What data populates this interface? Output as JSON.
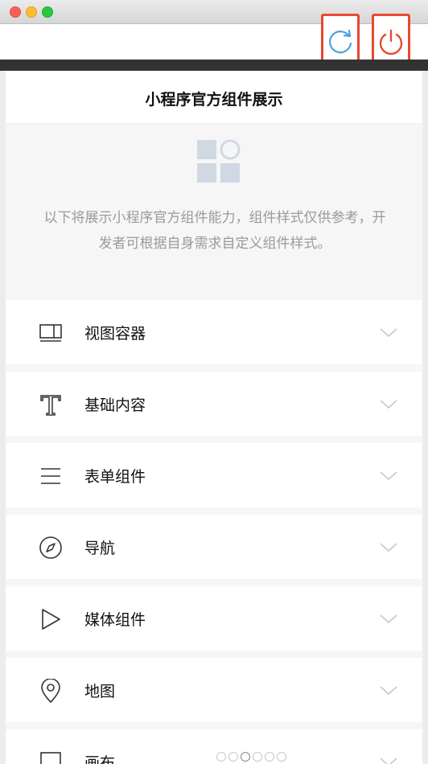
{
  "window": {
    "controls": [
      "close",
      "minimize",
      "zoom"
    ]
  },
  "toolbar": {
    "refresh_label": "刷新",
    "end_label": "结束",
    "refresh_icon": "refresh-icon",
    "power_icon": "power-icon",
    "accent_color": "#e8492f"
  },
  "page": {
    "title": "小程序官方组件展示",
    "intro_text": "以下将展示小程序官方组件能力，组件样式仅供参考，开发者可根据自身需求自定义组件样式。"
  },
  "menu": {
    "items": [
      {
        "label": "视图容器",
        "icon": "view-container-icon"
      },
      {
        "label": "基础内容",
        "icon": "text-icon"
      },
      {
        "label": "表单组件",
        "icon": "form-icon"
      },
      {
        "label": "导航",
        "icon": "compass-icon"
      },
      {
        "label": "媒体组件",
        "icon": "play-icon"
      },
      {
        "label": "地图",
        "icon": "location-icon"
      },
      {
        "label": "画布",
        "icon": "canvas-icon"
      }
    ]
  },
  "pager": {
    "count": 6,
    "active_index": 2
  }
}
